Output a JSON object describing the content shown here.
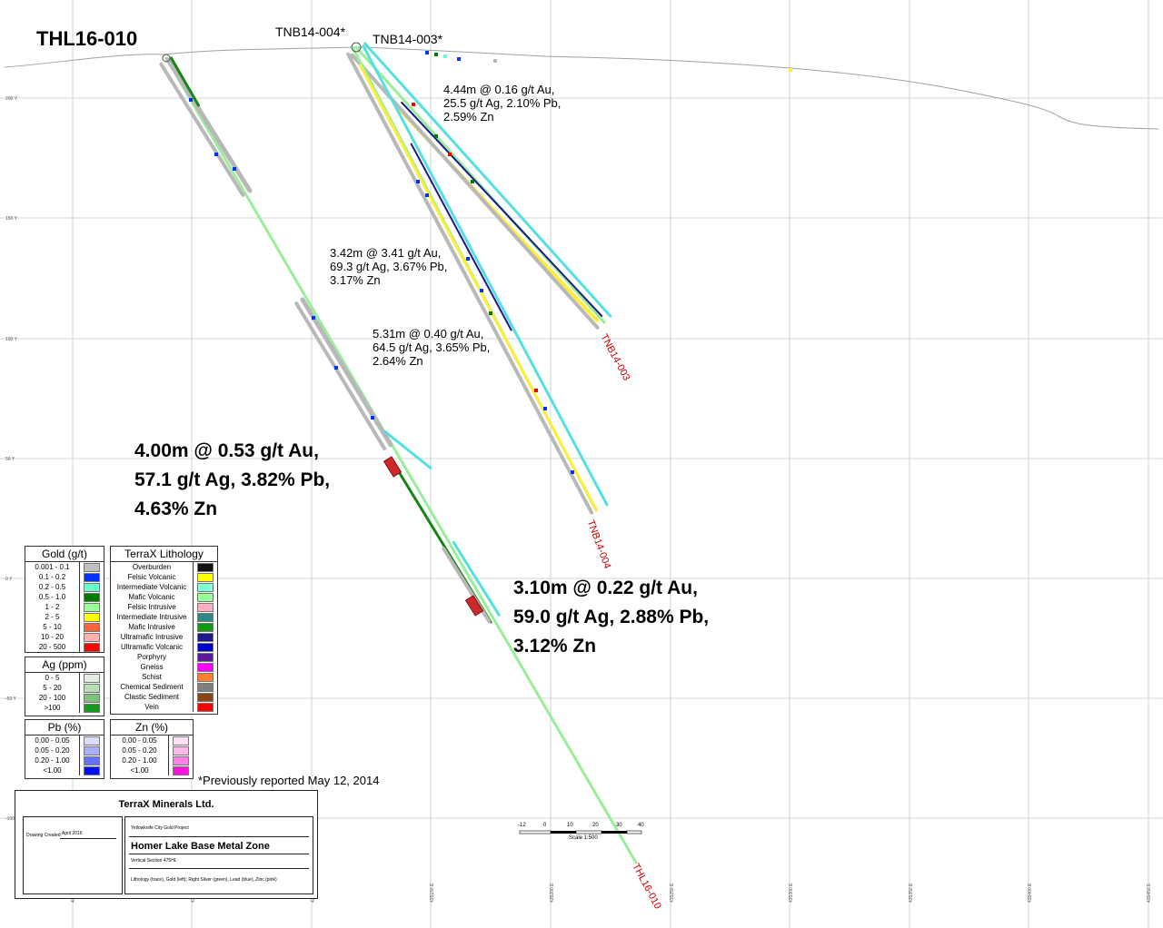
{
  "hole_title": "THL16-010",
  "collar_labels": [
    "TNB14-004*",
    "TNB14-003*"
  ],
  "intercepts_small": [
    "4.44m @ 0.16 g/t Au,\n25.5 g/t Ag, 2.10% Pb,\n2.59% Zn",
    "3.42m @ 3.41 g/t Au,\n69.3 g/t Ag, 3.67% Pb,\n3.17% Zn",
    "5.31m @ 0.40 g/t Au,\n64.5 g/t Ag, 3.65% Pb,\n2.64% Zn"
  ],
  "intercepts_big": [
    "4.00m @ 0.53 g/t Au,\n57.1 g/t Ag, 3.82% Pb,\n4.63% Zn",
    "3.10m @ 0.22 g/t Au,\n59.0 g/t Ag, 2.88% Pb,\n3.12% Zn"
  ],
  "trace_labels": [
    "TNB14-003",
    "TNB14-004",
    "THL16-010"
  ],
  "elevation_labels": [
    "200 Y",
    "150 Y",
    "100 Y",
    "50 Y",
    "0 Y",
    "-50 Y",
    "-100 Y"
  ],
  "easting_labels": [
    "435000 E",
    "435050 E",
    "435100 E",
    "435150 E",
    "435200 E",
    "435250 E",
    "435300 E",
    "435350 E",
    "435400 E",
    "435450 E"
  ],
  "legend": {
    "gold": {
      "title": "Gold (g/t)",
      "items": [
        {
          "label": "0.001 - 0.1",
          "color": "#c0c0c0"
        },
        {
          "label": "0.1 - 0.2",
          "color": "#0033ff"
        },
        {
          "label": "0.2 - 0.5",
          "color": "#66ffcc"
        },
        {
          "label": "0.5 - 1.0",
          "color": "#007a00"
        },
        {
          "label": "1 - 2",
          "color": "#99ff99"
        },
        {
          "label": "2 - 5",
          "color": "#ffff00"
        },
        {
          "label": "5 - 10",
          "color": "#ff6633"
        },
        {
          "label": "10 - 20",
          "color": "#ffb0b0"
        },
        {
          "label": "20 - 500",
          "color": "#ff0000"
        }
      ]
    },
    "ag": {
      "title": "Ag (ppm)",
      "items": [
        {
          "label": "0 - 5",
          "color": "#e0f0e0"
        },
        {
          "label": "5 - 20",
          "color": "#b8e0b8"
        },
        {
          "label": "20 - 100",
          "color": "#7cc47c"
        },
        {
          "label": ">100",
          "color": "#1a9a1a"
        }
      ]
    },
    "pb": {
      "title": "Pb (%)",
      "items": [
        {
          "label": "0.00 - 0.05",
          "color": "#dcdcff"
        },
        {
          "label": "0.05 - 0.20",
          "color": "#aab0ff"
        },
        {
          "label": "0.20 - 1.00",
          "color": "#6670ff"
        },
        {
          "label": "<1.00",
          "color": "#0010ff"
        }
      ]
    },
    "zn": {
      "title": "Zn (%)",
      "items": [
        {
          "label": "0.00 - 0.05",
          "color": "#ffe0f4"
        },
        {
          "label": "0.05 - 0.20",
          "color": "#ffb8ec"
        },
        {
          "label": "0.20 - 1.00",
          "color": "#ff80e4"
        },
        {
          "label": "<1.00",
          "color": "#ff10e0"
        }
      ]
    },
    "lithology": {
      "title": "TerraX Lithology",
      "items": [
        {
          "label": "Overburden",
          "color": "#111111"
        },
        {
          "label": "Felsic Volcanic",
          "color": "#ffff00"
        },
        {
          "label": "Intermediate Volcanic",
          "color": "#80ffd0"
        },
        {
          "label": "Mafic Volcanic",
          "color": "#99ff99"
        },
        {
          "label": "Felsic Intrusive",
          "color": "#ffb0c0"
        },
        {
          "label": "Intermediate Intrusive",
          "color": "#2a8a8a"
        },
        {
          "label": "Mafic Intrusive",
          "color": "#119911"
        },
        {
          "label": "Ultramafic Intrusive",
          "color": "#1a1a8a"
        },
        {
          "label": "Ultramafic Volcanic",
          "color": "#0000cc"
        },
        {
          "label": "Porphyry",
          "color": "#5a1a9a"
        },
        {
          "label": "Gneiss",
          "color": "#ff00ff"
        },
        {
          "label": "Schist",
          "color": "#ff7f2a"
        },
        {
          "label": "Chemical Sediment",
          "color": "#808080"
        },
        {
          "label": "Clastic Sediment",
          "color": "#8b4513"
        },
        {
          "label": "Vein",
          "color": "#ff0000"
        }
      ]
    }
  },
  "footnote": "*Previously reported May 12, 2014",
  "title_block": {
    "company": "TerraX Minerals Ltd.",
    "drawing_created_label": "Drawing Created:",
    "drawing_created_value": "April 2016",
    "project": "Yellowknife City Gold Project",
    "title": "Homer Lake Base Metal Zone",
    "section": "Vertical Section 475HL",
    "description": "Lithology (trace), Gold (left); Right Silver (green), Lead (blue), Zinc (pink)"
  },
  "scale_bar": {
    "ticks": [
      "-12",
      "0",
      "10",
      "20",
      "30",
      "40"
    ],
    "caption": "Scale 1:500"
  },
  "colors": {
    "grid": "#c8c8c8",
    "topography": "#9aa4a8",
    "trace_green": "#99ee99",
    "trace_darkgreen": "#118811",
    "trace_yellow": "#ffee33",
    "trace_cyan": "#55e0e0",
    "trace_navy": "#1a1a8a",
    "trace_grey": "#b8b8b8",
    "intercept_red": "#cc2a2a",
    "label_red": "#cc0000"
  }
}
